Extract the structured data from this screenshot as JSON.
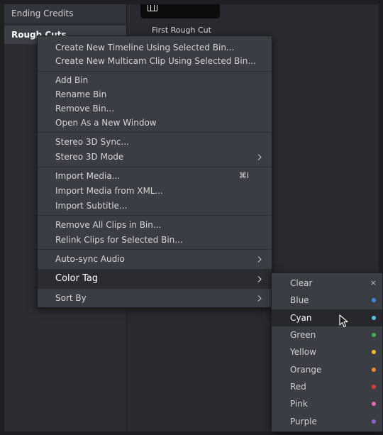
{
  "bins": {
    "items": [
      {
        "label": "Ending Credits"
      },
      {
        "label": "Rough Cuts"
      }
    ]
  },
  "clip": {
    "label": "First Rough Cut"
  },
  "context_menu": {
    "items": [
      {
        "label": "Create New Timeline Using Selected Bin..."
      },
      {
        "label": "Create New Multicam Clip Using Selected Bin..."
      },
      {
        "label": "Add Bin"
      },
      {
        "label": "Rename Bin"
      },
      {
        "label": "Remove Bin..."
      },
      {
        "label": "Open As a New Window"
      },
      {
        "label": "Stereo 3D Sync..."
      },
      {
        "label": "Stereo 3D Mode"
      },
      {
        "label": "Import Media...",
        "shortcut": "⌘I"
      },
      {
        "label": "Import Media from XML..."
      },
      {
        "label": "Import Subtitle..."
      },
      {
        "label": "Remove All Clips in Bin..."
      },
      {
        "label": "Relink Clips for Selected Bin..."
      },
      {
        "label": "Auto-sync Audio"
      },
      {
        "label": "Color Tag"
      },
      {
        "label": "Sort By"
      }
    ]
  },
  "color_tag_menu": {
    "items": [
      {
        "label": "Clear",
        "mark": "×"
      },
      {
        "label": "Blue",
        "color": "#3f86e0"
      },
      {
        "label": "Cyan",
        "color": "#56c6de"
      },
      {
        "label": "Green",
        "color": "#4caf50"
      },
      {
        "label": "Yellow",
        "color": "#f3c12f"
      },
      {
        "label": "Orange",
        "color": "#f08a2c"
      },
      {
        "label": "Red",
        "color": "#e23b3b"
      },
      {
        "label": "Pink",
        "color": "#e468b4"
      },
      {
        "label": "Purple",
        "color": "#8b62cc"
      }
    ]
  }
}
